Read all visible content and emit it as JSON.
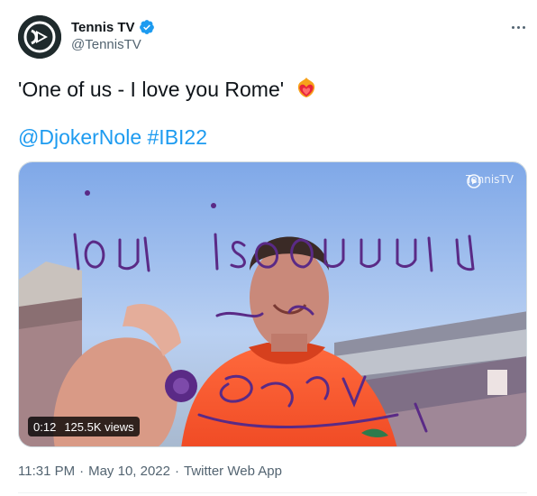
{
  "author": {
    "display_name": "Tennis TV",
    "handle": "@TennisTV",
    "verified": true,
    "avatar_icon": "tennis-tv-logo-icon"
  },
  "menu": {
    "icon": "more-options-icon"
  },
  "tweet": {
    "text": "'One of us - I love you Rome'",
    "emoji": "heart-on-fire-emoji",
    "mentions": [
      "@DjokerNole"
    ],
    "hashtags": [
      "#IBI22"
    ]
  },
  "media": {
    "watermark": "TennisTV",
    "duration": "0:12",
    "views": "125.5K views",
    "writing_color": "#5a2a86"
  },
  "footer": {
    "time": "11:31 PM",
    "date": "May 10, 2022",
    "client": "Twitter Web App"
  },
  "colors": {
    "accent": "#1d9bf0",
    "muted": "#536471",
    "text": "#0f1419"
  }
}
